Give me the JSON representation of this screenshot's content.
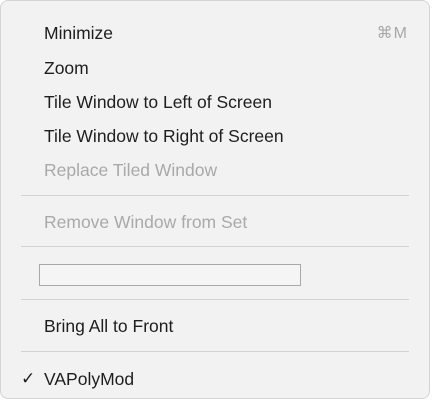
{
  "menu": {
    "items": [
      {
        "label": "Minimize",
        "shortcut": "⌘M"
      },
      {
        "label": "Zoom"
      },
      {
        "label": "Tile Window to Left of Screen"
      },
      {
        "label": "Tile Window to Right of Screen"
      },
      {
        "label": "Replace Tiled Window",
        "disabled": true
      },
      {
        "label": "Remove Window from Set",
        "disabled": true
      },
      {
        "label": "Bring All to Front"
      },
      {
        "label": "VAPolyMod",
        "checked": true,
        "check_mark": "✓"
      }
    ],
    "field_value": ""
  }
}
